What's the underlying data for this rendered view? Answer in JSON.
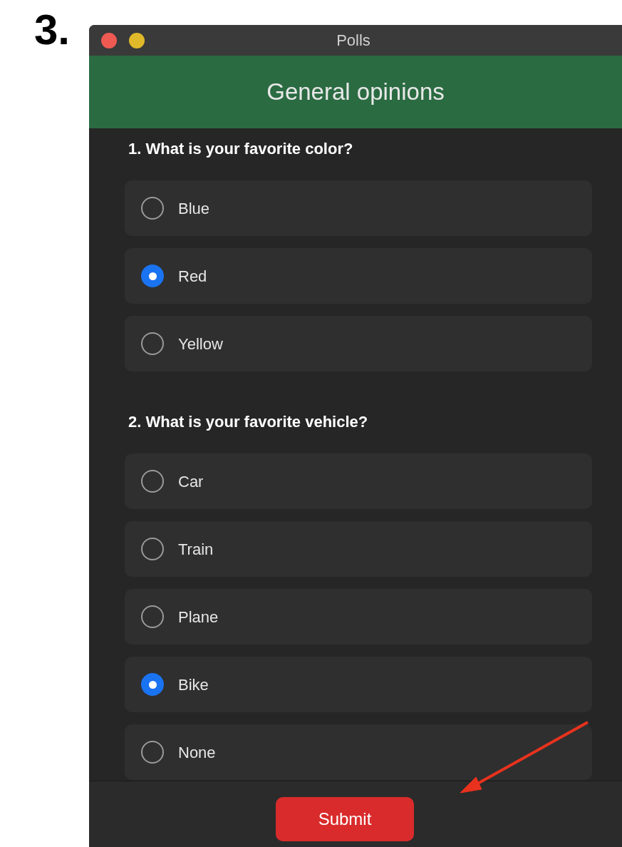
{
  "step_label": "3.",
  "window": {
    "title": "Polls"
  },
  "poll": {
    "title": "General opinions",
    "questions": [
      {
        "text": "1. What is your favorite color?",
        "options": [
          {
            "label": "Blue",
            "selected": false
          },
          {
            "label": "Red",
            "selected": true
          },
          {
            "label": "Yellow",
            "selected": false
          }
        ]
      },
      {
        "text": "2. What is your favorite vehicle?",
        "options": [
          {
            "label": "Car",
            "selected": false
          },
          {
            "label": "Train",
            "selected": false
          },
          {
            "label": "Plane",
            "selected": false
          },
          {
            "label": "Bike",
            "selected": true
          },
          {
            "label": "None",
            "selected": false
          }
        ]
      }
    ]
  },
  "submit_button": "Submit"
}
